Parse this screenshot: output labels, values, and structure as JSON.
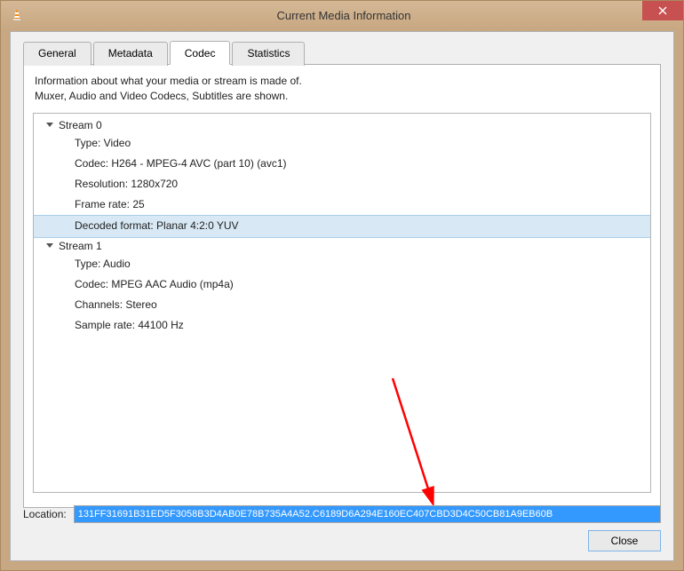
{
  "window": {
    "title": "Current Media Information",
    "close_icon": "close-icon"
  },
  "tabs": [
    {
      "label": "General",
      "active": false
    },
    {
      "label": "Metadata",
      "active": false
    },
    {
      "label": "Codec",
      "active": true
    },
    {
      "label": "Statistics",
      "active": false
    }
  ],
  "panel": {
    "info_line1": "Information about what your media or stream is made of.",
    "info_line2": "Muxer, Audio and Video Codecs, Subtitles are shown."
  },
  "streams": [
    {
      "name": "Stream 0",
      "rows": [
        {
          "text": "Type: Video",
          "selected": false
        },
        {
          "text": "Codec: H264 - MPEG-4 AVC (part 10) (avc1)",
          "selected": false
        },
        {
          "text": "Resolution: 1280x720",
          "selected": false
        },
        {
          "text": "Frame rate: 25",
          "selected": false
        },
        {
          "text": "Decoded format: Planar 4:2:0 YUV",
          "selected": true
        }
      ]
    },
    {
      "name": "Stream 1",
      "rows": [
        {
          "text": "Type: Audio",
          "selected": false
        },
        {
          "text": "Codec: MPEG AAC Audio (mp4a)",
          "selected": false
        },
        {
          "text": "Channels: Stereo",
          "selected": false
        },
        {
          "text": "Sample rate: 44100 Hz",
          "selected": false
        }
      ]
    }
  ],
  "location": {
    "label": "Location:",
    "value": "131FF31691B31ED5F3058B3D4AB0E78B735A4A52.C6189D6A294E160EC407CBD3D4C50CB81A9EB60B"
  },
  "buttons": {
    "close": "Close"
  },
  "colors": {
    "selection_bg": "#d8e9f5",
    "location_highlight": "#3399ff",
    "close_btn": "#c75050",
    "arrow": "#ff0000"
  }
}
